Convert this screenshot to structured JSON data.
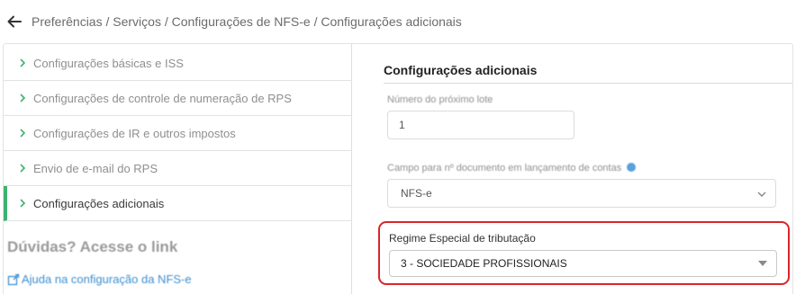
{
  "breadcrumb": "Preferências / Serviços / Configurações de NFS-e / Configurações adicionais",
  "sidebar": {
    "items": [
      {
        "label": "Configurações básicas e ISS"
      },
      {
        "label": "Configurações de controle de numeração de RPS"
      },
      {
        "label": "Configurações de IR e outros impostos"
      },
      {
        "label": "Envio de e-mail do RPS"
      },
      {
        "label": "Configurações adicionais",
        "active": true
      }
    ],
    "help_title": "Dúvidas? Acesse o link",
    "help_link": "Ajuda na configuração da NFS-e"
  },
  "main": {
    "title": "Configurações adicionais",
    "next_batch_label": "Número do próximo lote",
    "next_batch_value": "1",
    "doc_field_label": "Campo para nº documento em lançamento de contas",
    "doc_field_value": "NFS-e",
    "regime_label": "Regime Especial de tributação",
    "regime_value": "3 - SOCIEDADE PROFISSIONAIS"
  },
  "colors": {
    "active_indicator": "#3cb371",
    "highlight_border": "#d9262b",
    "link": "#3d8fd1",
    "info_icon": "#5aa0dd"
  }
}
